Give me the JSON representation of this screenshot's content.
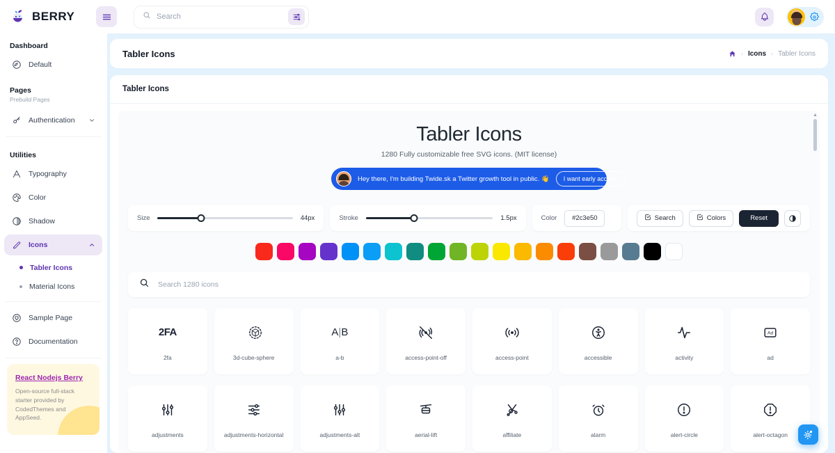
{
  "brand": {
    "name": "BERRY"
  },
  "topbar": {
    "menu_icon": "hamburger-icon",
    "search_placeholder": "Search",
    "search_value": "",
    "filter_icon": "filter-sliders-icon",
    "bell_icon": "bell-icon",
    "gear_icon": "gear-icon",
    "avatar": "user-avatar"
  },
  "sidebar": {
    "groups": [
      {
        "label": "Dashboard",
        "caption": ""
      },
      {
        "label": "Pages",
        "caption": "Prebuild Pages"
      },
      {
        "label": "Utilities",
        "caption": ""
      }
    ],
    "dashboard_items": [
      {
        "label": "Default",
        "icon": "dashboard-circle-icon"
      }
    ],
    "pages_items": [
      {
        "label": "Authentication",
        "icon": "key-icon",
        "chevron": "chevron-down-icon"
      }
    ],
    "utilities_items": [
      {
        "label": "Typography",
        "icon": "typography-icon"
      },
      {
        "label": "Color",
        "icon": "palette-icon"
      },
      {
        "label": "Shadow",
        "icon": "shadow-icon"
      },
      {
        "label": "Icons",
        "icon": "pencil-icon",
        "chevron": "chevron-up-icon",
        "active": true
      }
    ],
    "icons_children": [
      {
        "label": "Tabler Icons",
        "selected": true
      },
      {
        "label": "Material Icons",
        "selected": false
      }
    ],
    "other_items": [
      {
        "label": "Sample Page",
        "icon": "shield-icon"
      },
      {
        "label": "Documentation",
        "icon": "help-circle-icon"
      }
    ],
    "promo": {
      "title": "React Nodejs Berry",
      "body": "Open-source full-stack starter provided by CodedThemes and AppSeed."
    }
  },
  "page": {
    "title": "Tabler Icons",
    "breadcrumb": {
      "home_icon": "home-icon",
      "items": [
        {
          "label": "Icons",
          "current": false
        },
        {
          "label": "Tabler Icons",
          "current": true
        }
      ]
    }
  },
  "panel": {
    "title": "Tabler Icons"
  },
  "hero": {
    "title": "Tabler Icons",
    "subtitle": "1280 Fully customizable free SVG icons. (MIT license)",
    "banner": {
      "avatar": "promo-avatar",
      "text": "Hey there, I'm building Twide.sk a Twitter growth tool in public. 👋",
      "button": "I want early access.",
      "background": "#1c5ce7"
    }
  },
  "controls": {
    "size": {
      "label": "Size",
      "value": "44px",
      "percent": 32
    },
    "stroke": {
      "label": "Stroke",
      "value": "1.5px",
      "percent": 38
    },
    "color": {
      "label": "Color",
      "value": "#2c3e50"
    },
    "buttons": [
      {
        "label": "Search",
        "icon": "check-square-icon",
        "style": "light"
      },
      {
        "label": "Colors",
        "icon": "check-square-icon",
        "style": "light"
      },
      {
        "label": "Reset",
        "icon": "",
        "style": "dark"
      }
    ],
    "theme_toggle": {
      "label": "",
      "icon": "contrast-icon"
    }
  },
  "swatches": [
    "#f92a1c",
    "#fa0866",
    "#a605c1",
    "#6533cc",
    "#0091f7",
    "#0b9ef6",
    "#0dc3cf",
    "#108d80",
    "#00a635",
    "#70b526",
    "#bcd406",
    "#fae800",
    "#fbb900",
    "#fb8c00",
    "#fa3e0a",
    "#7b4f43",
    "#9a9a9a",
    "#577b91",
    "#000000",
    "#ffffff"
  ],
  "icon_search": {
    "placeholder": "Search 1280 icons",
    "value": "",
    "icon": "search-icon"
  },
  "icon_grid": {
    "row1": [
      {
        "name": "2fa",
        "glyph": "2FA"
      },
      {
        "name": "3d-cube-sphere",
        "glyph": "cube-sphere-icon"
      },
      {
        "name": "a-b",
        "glyph": "A|B"
      },
      {
        "name": "access-point-off",
        "glyph": "access-point-off-icon"
      },
      {
        "name": "access-point",
        "glyph": "access-point-icon"
      },
      {
        "name": "accessible",
        "glyph": "accessible-icon"
      },
      {
        "name": "activity",
        "glyph": "activity-icon"
      },
      {
        "name": "ad",
        "glyph": "Ad"
      }
    ],
    "row2": [
      {
        "name": "adjustments",
        "glyph": "adjustments-icon"
      },
      {
        "name": "adjustments-horizontal",
        "glyph": "adjustments-horizontal-icon"
      },
      {
        "name": "adjustments-alt",
        "glyph": "adjustments-alt-icon"
      },
      {
        "name": "aerial-lift",
        "glyph": "aerial-lift-icon"
      },
      {
        "name": "affiliate",
        "glyph": "affiliate-icon"
      },
      {
        "name": "alarm",
        "glyph": "alarm-icon"
      },
      {
        "name": "alert-circle",
        "glyph": "alert-circle-icon"
      },
      {
        "name": "alert-octagon",
        "glyph": "alert-octagon-icon"
      }
    ]
  },
  "fab": {
    "icon": "settings-customize-icon",
    "color": "#2196f3"
  },
  "colors": {
    "accent": "#5e35b1",
    "main_bg": "#e3f2fd",
    "dark": "#1b2433"
  }
}
